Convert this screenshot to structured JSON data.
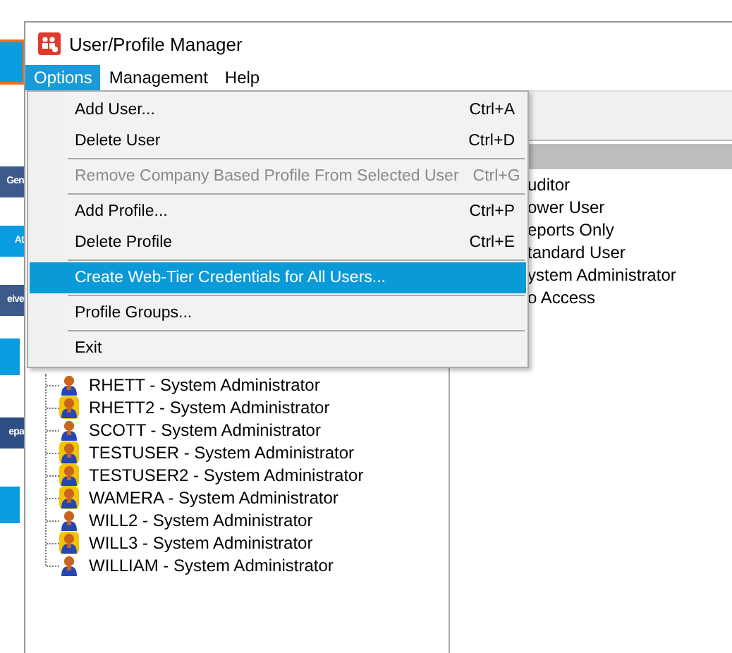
{
  "background_buttons": [
    {
      "label": "Gen",
      "kind": "slate"
    },
    {
      "label": "At",
      "kind": "cyan"
    },
    {
      "label": "eive",
      "kind": "slate"
    },
    {
      "label": "epa",
      "kind": "navy"
    }
  ],
  "window": {
    "title": "User/Profile Manager"
  },
  "menu_bar": [
    {
      "label": "Options",
      "selected": true
    },
    {
      "label": "Management",
      "selected": false
    },
    {
      "label": "Help",
      "selected": false
    }
  ],
  "menu": [
    {
      "kind": "item",
      "label": "Add User...",
      "shortcut": "Ctrl+A",
      "disabled": false,
      "selected": false
    },
    {
      "kind": "item",
      "label": "Delete User",
      "shortcut": "Ctrl+D",
      "disabled": false,
      "selected": false
    },
    {
      "kind": "separator"
    },
    {
      "kind": "item",
      "label": "Remove Company Based Profile From Selected User",
      "shortcut": "Ctrl+G",
      "disabled": true,
      "selected": false
    },
    {
      "kind": "separator"
    },
    {
      "kind": "item",
      "label": "Add Profile...",
      "shortcut": "Ctrl+P",
      "disabled": false,
      "selected": false
    },
    {
      "kind": "item",
      "label": "Delete Profile",
      "shortcut": "Ctrl+E",
      "disabled": false,
      "selected": false
    },
    {
      "kind": "separator"
    },
    {
      "kind": "item",
      "label": "Create Web-Tier Credentials for All Users...",
      "disabled": false,
      "selected": true
    },
    {
      "kind": "separator"
    },
    {
      "kind": "item",
      "label": "Profile Groups...",
      "disabled": false,
      "selected": false
    },
    {
      "kind": "separator"
    },
    {
      "kind": "item",
      "label": "Exit",
      "disabled": false,
      "selected": false
    }
  ],
  "users": [
    {
      "label": "RHETT - System Administrator",
      "highlighted": false
    },
    {
      "label": "RHETT2 - System Administrator",
      "highlighted": true
    },
    {
      "label": "SCOTT - System Administrator",
      "highlighted": false
    },
    {
      "label": "TESTUSER - System Administrator",
      "highlighted": true
    },
    {
      "label": "TESTUSER2 - System Administrator",
      "highlighted": true
    },
    {
      "label": "WAMERA - System Administrator",
      "highlighted": true
    },
    {
      "label": "WILL2 - System Administrator",
      "highlighted": false
    },
    {
      "label": "WILL3 - System Administrator",
      "highlighted": true
    },
    {
      "label": "WILLIAM - System Administrator",
      "highlighted": false
    }
  ],
  "profiles": [
    "uditor",
    "ower User",
    "eports Only",
    "tandard User",
    "ystem Administrator",
    "o Access"
  ]
}
